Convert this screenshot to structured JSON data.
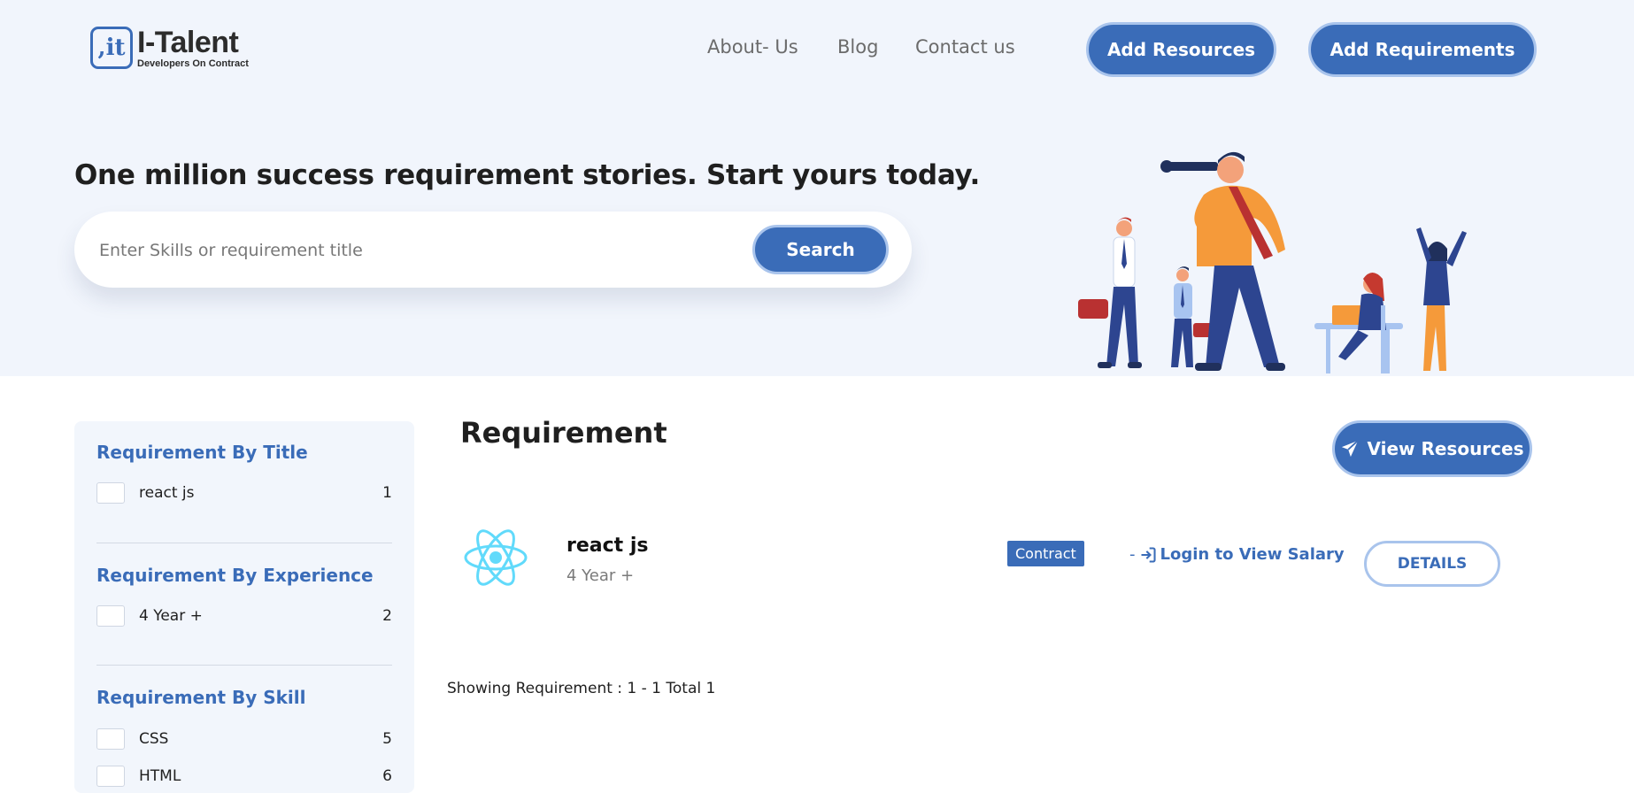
{
  "logo": {
    "mark": ",it",
    "name": "I-Talent",
    "tagline": "Developers On Contract"
  },
  "nav": {
    "about": "About- Us",
    "blog": "Blog",
    "contact": "Contact us"
  },
  "header_buttons": {
    "add_resources": "Add Resources",
    "add_requirements": "Add Requirements"
  },
  "hero": {
    "headline": "One million success requirement stories. Start yours today.",
    "search_placeholder": "Enter Skills or requirement title",
    "search_button": "Search"
  },
  "sidebar": {
    "groups": [
      {
        "title": "Requirement By Title",
        "items": [
          {
            "label": "react js",
            "count": "1"
          }
        ]
      },
      {
        "title": "Requirement By Experience",
        "items": [
          {
            "label": "4 Year +",
            "count": "2"
          }
        ]
      },
      {
        "title": "Requirement By Skill",
        "items": [
          {
            "label": "CSS",
            "count": "5"
          },
          {
            "label": "HTML",
            "count": "6"
          }
        ]
      }
    ]
  },
  "main": {
    "title": "Requirement",
    "view_resources": "View Resources",
    "jobs": [
      {
        "title": "react js",
        "experience": "4 Year +",
        "type": "Contract",
        "salary_prefix": "-",
        "salary_text": "Login to View Salary",
        "details": "DETAILS"
      }
    ],
    "showing": "Showing Requirement : 1 - 1 Total 1"
  },
  "colors": {
    "primary": "#3a6cb8",
    "hero_bg": "#f1f5fc",
    "react": "#61dafb"
  }
}
